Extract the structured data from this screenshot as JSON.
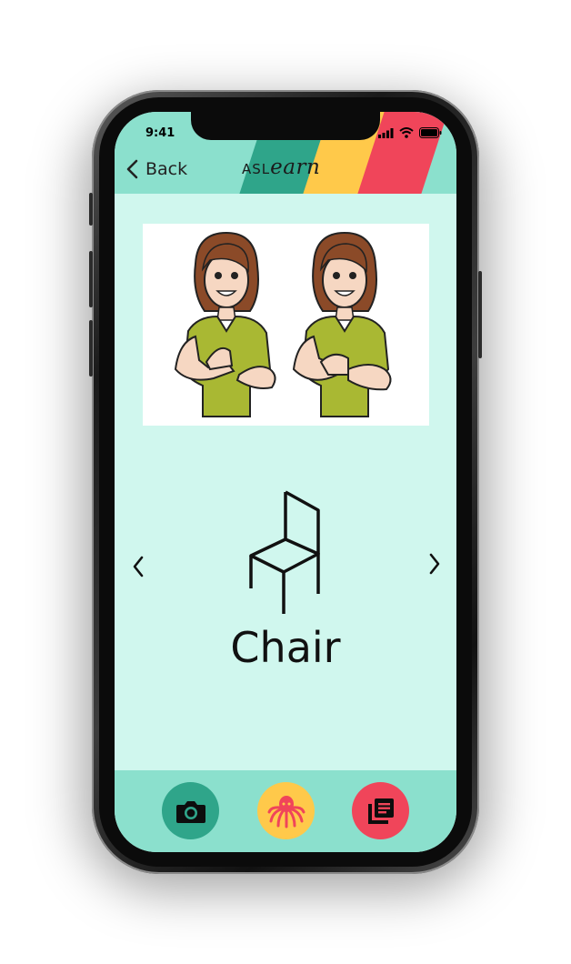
{
  "status": {
    "time": "9:41"
  },
  "header": {
    "back_label": "Back",
    "logo_prefix": "ASL",
    "logo_suffix": "earn"
  },
  "lesson": {
    "word": "Chair",
    "image_desc_icon": "chair-icon",
    "sign_image_icon": "sign-illustration"
  },
  "navigation": {
    "prev_icon": "chevron-left-icon",
    "next_icon": "chevron-right-icon"
  },
  "tabs": [
    {
      "name": "camera",
      "icon": "camera-icon",
      "color": "#2fa58a"
    },
    {
      "name": "octopus",
      "icon": "octopus-icon",
      "color": "#ffc94a"
    },
    {
      "name": "dictionary",
      "icon": "book-icon",
      "color": "#f0455a"
    }
  ],
  "colors": {
    "background": "#d0f7ee",
    "header": "#8be0cd",
    "stripe_green": "#2fa58a",
    "stripe_yellow": "#ffc94a",
    "stripe_red": "#f0455a"
  }
}
